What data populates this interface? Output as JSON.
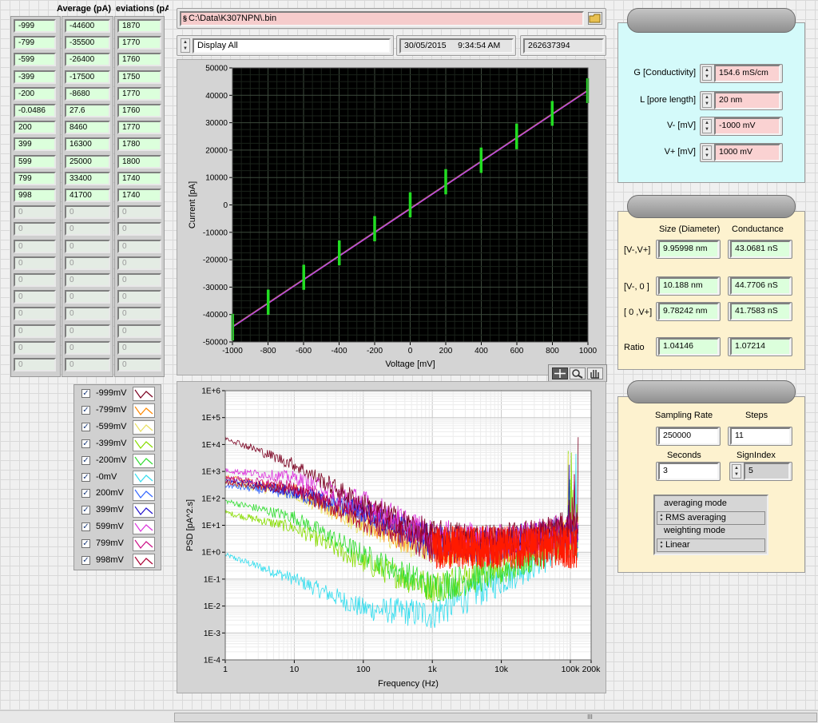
{
  "table": {
    "headers": [
      "Average (pA)",
      "eviations (pA)"
    ],
    "voltage": [
      "-999",
      "-799",
      "-599",
      "-399",
      "-200",
      "-0.0486",
      "200",
      "399",
      "599",
      "799",
      "998",
      "0",
      "0",
      "0",
      "0",
      "0",
      "0",
      "0",
      "0",
      "0",
      "0"
    ],
    "average": [
      "-44600",
      "-35500",
      "-26400",
      "-17500",
      "-8680",
      "27.6",
      "8460",
      "16300",
      "25000",
      "33400",
      "41700",
      "0",
      "0",
      "0",
      "0",
      "0",
      "0",
      "0",
      "0",
      "0",
      "0"
    ],
    "deviation": [
      "1870",
      "1770",
      "1760",
      "1750",
      "1770",
      "1760",
      "1770",
      "1780",
      "1800",
      "1740",
      "1740",
      "0",
      "0",
      "0",
      "0",
      "0",
      "0",
      "0",
      "0",
      "0",
      "0"
    ]
  },
  "file_path": "C:\\Data\\K307NPN\\.bin",
  "display_mode": "Display All",
  "date": "30/05/2015",
  "time": "9:34:54 AM",
  "counter": "262637394",
  "iv_chart": {
    "xlabel": "Voltage [mV]",
    "ylabel": "Current [pA]",
    "x_ticks": [
      "-1000",
      "-800",
      "-600",
      "-400",
      "-200",
      "0",
      "200",
      "400",
      "600",
      "800",
      "1000"
    ],
    "y_ticks": [
      "50000",
      "40000",
      "30000",
      "20000",
      "10000",
      "0",
      "-10000",
      "-20000",
      "-30000",
      "-40000",
      "-50000"
    ]
  },
  "psd_chart": {
    "xlabel": "Frequency (Hz)",
    "ylabel": "PSD [pA^2.s]",
    "x_ticks": [
      "1",
      "10",
      "100",
      "1k",
      "10k",
      "100k",
      "200k"
    ],
    "y_ticks": [
      "1E+6",
      "1E+5",
      "1E+4",
      "1E+3",
      "1E+2",
      "1E+1",
      "1E+0",
      "1E-1",
      "1E-2",
      "1E-3",
      "1E-4"
    ]
  },
  "chart_data": [
    {
      "type": "scatter",
      "xlabel": "Voltage [mV]",
      "ylabel": "Current [pA]",
      "xlim": [
        -1000,
        1000
      ],
      "ylim": [
        -50000,
        50000
      ],
      "x": [
        -999,
        -799,
        -599,
        -399,
        -200,
        -0.0486,
        200,
        399,
        599,
        799,
        998
      ],
      "y": [
        -44600,
        -35500,
        -26400,
        -17500,
        -8680,
        27.6,
        8460,
        16300,
        25000,
        33400,
        41700
      ],
      "error": [
        1870,
        1770,
        1760,
        1750,
        1770,
        1760,
        1770,
        1780,
        1800,
        1740,
        1740
      ],
      "fit_line": {
        "x": [
          -1000,
          1000
        ],
        "y": [
          -44500,
          41800
        ]
      },
      "error_bar_color": "#22dd22",
      "background": "#000000",
      "grid": true
    },
    {
      "type": "line",
      "xlabel": "Frequency (Hz)",
      "ylabel": "PSD [pA^2.s]",
      "x_scale": "log",
      "y_scale": "log",
      "xlim": [
        1,
        200000
      ],
      "ylim": [
        0.0001,
        1000000
      ],
      "grid": true,
      "series": [
        {
          "name": "-999mV",
          "color": "#7a0020",
          "x": [
            1,
            10,
            100,
            1000,
            10000,
            100000
          ],
          "y": [
            18000,
            1800,
            60,
            4,
            3,
            8
          ]
        },
        {
          "name": "-799mV",
          "color": "#ff8800",
          "x": [
            1,
            10,
            100,
            1000,
            10000,
            100000
          ],
          "y": [
            600,
            200,
            12,
            1.5,
            1.5,
            5
          ]
        },
        {
          "name": "-599mV",
          "color": "#e8e060",
          "x": [
            1,
            10,
            100,
            1000,
            10000,
            100000
          ],
          "y": [
            400,
            150,
            10,
            1.2,
            1.4,
            5
          ]
        },
        {
          "name": "-399mV",
          "color": "#88dd00",
          "x": [
            1,
            10,
            100,
            1000,
            10000,
            100000
          ],
          "y": [
            30,
            8,
            0.4,
            0.05,
            0.3,
            3
          ]
        },
        {
          "name": "-200mV",
          "color": "#33dd33",
          "x": [
            1,
            10,
            100,
            1000,
            10000,
            100000
          ],
          "y": [
            80,
            20,
            0.8,
            0.05,
            0.2,
            3
          ]
        },
        {
          "name": "-0mV",
          "color": "#33ddee",
          "x": [
            1,
            10,
            100,
            1000,
            10000,
            100000
          ],
          "y": [
            0.8,
            0.1,
            0.008,
            0.005,
            0.1,
            2
          ]
        },
        {
          "name": "200mV",
          "color": "#3366ff",
          "x": [
            1,
            10,
            100,
            1000,
            10000,
            100000
          ],
          "y": [
            300,
            150,
            30,
            2,
            1.5,
            5
          ]
        },
        {
          "name": "399mV",
          "color": "#2211cc",
          "x": [
            1,
            10,
            100,
            1000,
            10000,
            100000
          ],
          "y": [
            500,
            180,
            35,
            3,
            2,
            6
          ]
        },
        {
          "name": "599mV",
          "color": "#dd33dd",
          "x": [
            1,
            10,
            100,
            1000,
            10000,
            100000
          ],
          "y": [
            1100,
            600,
            80,
            4,
            2.5,
            7
          ]
        },
        {
          "name": "799mV",
          "color": "#cc1188",
          "x": [
            1,
            10,
            100,
            1000,
            10000,
            100000
          ],
          "y": [
            600,
            250,
            40,
            3,
            2,
            6
          ]
        },
        {
          "name": "998mV",
          "color": "#aa0033",
          "x": [
            1,
            10,
            100,
            1000,
            10000,
            100000
          ],
          "y": [
            400,
            200,
            15,
            1.5,
            2,
            8
          ]
        }
      ]
    }
  ],
  "legend": [
    {
      "label": "-999mV",
      "color": "#7a0020"
    },
    {
      "label": "-799mV",
      "color": "#ff8800"
    },
    {
      "label": "-599mV",
      "color": "#e8e060"
    },
    {
      "label": "-399mV",
      "color": "#88dd00"
    },
    {
      "label": "-200mV",
      "color": "#33dd33"
    },
    {
      "label": "-0mV",
      "color": "#33ddee"
    },
    {
      "label": "200mV",
      "color": "#3366ff"
    },
    {
      "label": "399mV",
      "color": "#2211cc"
    },
    {
      "label": "599mV",
      "color": "#dd33dd"
    },
    {
      "label": "799mV",
      "color": "#cc1188"
    },
    {
      "label": "998mV",
      "color": "#aa0033"
    }
  ],
  "params": {
    "g_label": "G [Conductivity]",
    "g_value": "154.6 mS/cm",
    "l_label": "L [pore length]",
    "l_value": "20 nm",
    "vminus_label": "V- [mV]",
    "vminus_value": "-1000 mV",
    "vplus_label": "V+ [mV]",
    "vplus_value": "1000 mV",
    "color": "#d4fafa"
  },
  "results": {
    "size_header": "Size (Diameter)",
    "cond_header": "Conductance",
    "rows": [
      {
        "label": "[V-,V+]",
        "size": "9.95998 nm",
        "cond": "43.0681 nS"
      },
      {
        "label": "[V-, 0 ]",
        "size": "10.188 nm",
        "cond": "44.7706 nS"
      },
      {
        "label": "[ 0 ,V+]",
        "size": "9.78242 nm",
        "cond": "41.7583 nS"
      },
      {
        "label": "Ratio",
        "size": "1.04146",
        "cond": "1.07214"
      }
    ],
    "color": "#fdf2cf"
  },
  "sampling": {
    "rate_label": "Sampling Rate",
    "rate_value": "250000",
    "steps_label": "Steps",
    "steps_value": "11",
    "seconds_label": "Seconds",
    "seconds_value": "3",
    "signindex_label": "SignIndex",
    "signindex_value": "5",
    "averaging_label": "averaging mode",
    "averaging_value": "RMS averaging",
    "weighting_label": "weighting mode",
    "weighting_value": "Linear"
  },
  "scrollbar_grip": "III"
}
